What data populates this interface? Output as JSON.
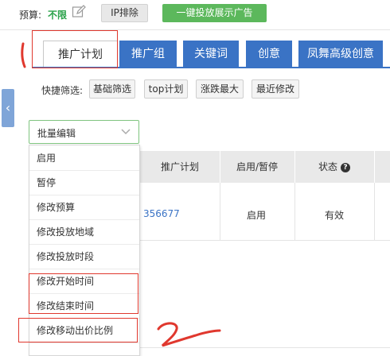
{
  "topbar": {
    "budget_label": "预算:",
    "budget_value": "不限",
    "ip_button": "IP排除",
    "ad_button": "一键投放展示广告"
  },
  "side_handle_glyph": "‹",
  "tabs": [
    {
      "label": "推广计划",
      "active": true
    },
    {
      "label": "推广组",
      "active": false
    },
    {
      "label": "关键词",
      "active": false
    },
    {
      "label": "创意",
      "active": false
    },
    {
      "label": "凤舞高级创意",
      "active": false
    }
  ],
  "quick_filter": {
    "label": "快捷筛选:",
    "buttons": [
      "基础筛选",
      "top计划",
      "涨跌最大",
      "最近修改"
    ]
  },
  "batch": {
    "label": "批量编辑"
  },
  "table": {
    "headers": [
      "推广计划",
      "启用/暂停",
      "状态"
    ],
    "help_glyph": "?",
    "row": {
      "plan": "356677",
      "toggle": "启用",
      "status": "有效"
    }
  },
  "dropdown": {
    "items": [
      "启用",
      "暂停",
      "修改预算",
      "修改投放地域",
      "修改投放时段",
      "修改开始时间",
      "修改结束时间",
      "修改移动出价比例"
    ]
  },
  "colors": {
    "accent_blue": "#3a73c5",
    "green": "#5cb85c",
    "annotation_red": "#e0382e"
  }
}
